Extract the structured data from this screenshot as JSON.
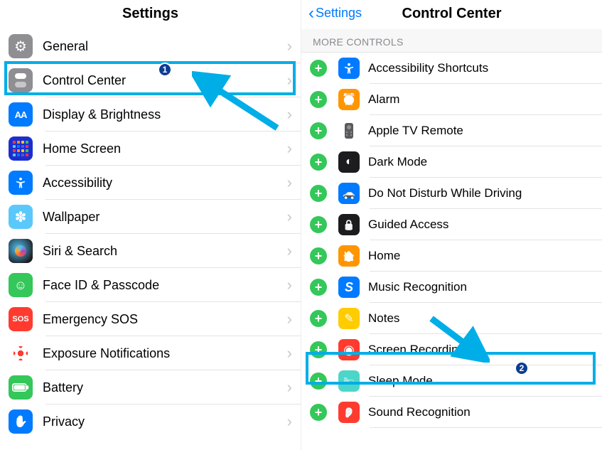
{
  "left": {
    "title": "Settings",
    "items": [
      {
        "label": "General",
        "icon": "gear",
        "bg": "bg-gray"
      },
      {
        "label": "Control Center",
        "icon": "toggle",
        "bg": "bg-gray"
      },
      {
        "label": "Display & Brightness",
        "icon": "aa",
        "bg": "bg-blue"
      },
      {
        "label": "Home Screen",
        "icon": "grid",
        "bg": "bg-blue"
      },
      {
        "label": "Accessibility",
        "icon": "access",
        "bg": "bg-blue"
      },
      {
        "label": "Wallpaper",
        "icon": "flower",
        "bg": "bg-teal"
      },
      {
        "label": "Siri & Search",
        "icon": "siri",
        "bg": "bg-black"
      },
      {
        "label": "Face ID & Passcode",
        "icon": "face",
        "bg": "bg-green"
      },
      {
        "label": "Emergency SOS",
        "icon": "sos",
        "bg": "bg-red"
      },
      {
        "label": "Exposure Notifications",
        "icon": "covid",
        "bg": "bg-white"
      },
      {
        "label": "Battery",
        "icon": "battery",
        "bg": "bg-green"
      },
      {
        "label": "Privacy",
        "icon": "hand",
        "bg": "bg-blue"
      }
    ]
  },
  "right": {
    "back_label": "Settings",
    "title": "Control Center",
    "section": "MORE CONTROLS",
    "items": [
      {
        "label": "Accessibility Shortcuts",
        "icon": "access",
        "bg": "bg-blue"
      },
      {
        "label": "Alarm",
        "icon": "alarm",
        "bg": "bg-orange"
      },
      {
        "label": "Apple TV Remote",
        "icon": "remote",
        "bg": "bg-gray"
      },
      {
        "label": "Dark Mode",
        "icon": "dark",
        "bg": "bg-black"
      },
      {
        "label": "Do Not Disturb While Driving",
        "icon": "car",
        "bg": "bg-blue"
      },
      {
        "label": "Guided Access",
        "icon": "lock",
        "bg": "bg-black"
      },
      {
        "label": "Home",
        "icon": "home",
        "bg": "bg-orange"
      },
      {
        "label": "Music Recognition",
        "icon": "shazam",
        "bg": "bg-blue"
      },
      {
        "label": "Notes",
        "icon": "notes",
        "bg": "bg-yellow"
      },
      {
        "label": "Screen Recording",
        "icon": "record",
        "bg": "bg-red"
      },
      {
        "label": "Sleep Mode",
        "icon": "sleep",
        "bg": "bg-teal"
      },
      {
        "label": "Sound Recognition",
        "icon": "sound",
        "bg": "bg-red"
      }
    ]
  },
  "annotations": {
    "highlight_color": "#00aee7",
    "badges": [
      "1",
      "2"
    ],
    "highlight_left_index": 1,
    "highlight_right_index": 9
  }
}
